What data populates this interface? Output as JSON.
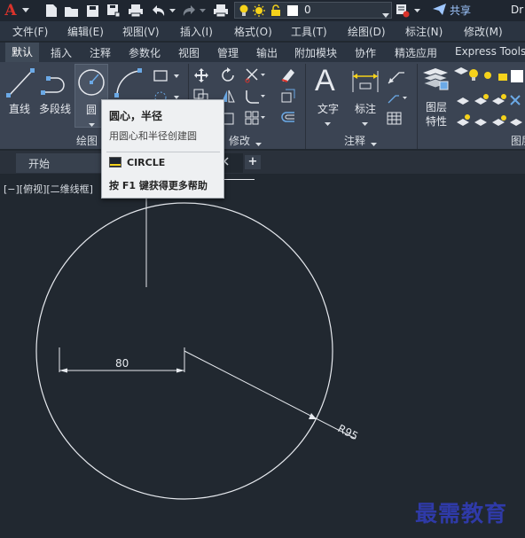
{
  "quick_access": {
    "app_logo": "A",
    "icons": [
      "app-logo-icon",
      "new-icon",
      "open-icon",
      "save-icon",
      "saveas-icon",
      "plot-icon",
      "undo-icon",
      "redo-icon",
      "print-icon"
    ],
    "layer_value": "0",
    "share_label": "共享",
    "doc_title": "Dr"
  },
  "menu": [
    "文件(F)",
    "编辑(E)",
    "视图(V)",
    "插入(I)",
    "格式(O)",
    "工具(T)",
    "绘图(D)",
    "标注(N)",
    "修改(M)"
  ],
  "ribbon_tabs": [
    "默认",
    "插入",
    "注释",
    "参数化",
    "视图",
    "管理",
    "输出",
    "附加模块",
    "协作",
    "精选应用",
    "Express Tools"
  ],
  "ribbon": {
    "line_label": "直线",
    "polyline_label": "多段线",
    "circle_label": "圆",
    "draw_panel": "绘图",
    "modify_panel": "修改",
    "text_label": "文字",
    "dimension_label": "标注",
    "annotation_panel": "注释",
    "layer_props_label1": "图层",
    "layer_props_label2": "特性",
    "layers_panel": "图层"
  },
  "file_tabs": {
    "start_label": "开始",
    "add_label": "+"
  },
  "viewport_label": "[−][俯视][二维线框]",
  "tooltip": {
    "title": "圆心，半径",
    "description": "用圆心和半径创建圆",
    "command": "CIRCLE",
    "help": "按 F1 键获得更多帮助"
  },
  "drawing": {
    "dimension_text": "80",
    "radius_text": "R95"
  },
  "watermark": "最需教育",
  "colors": {
    "background": "#212830",
    "ribbon": "#3b4453",
    "menubar": "#2b3441",
    "tooltip_bg": "#eef0f2",
    "drawing_line": "#e6e9ee",
    "accent_blue": "#9fc7ff"
  }
}
